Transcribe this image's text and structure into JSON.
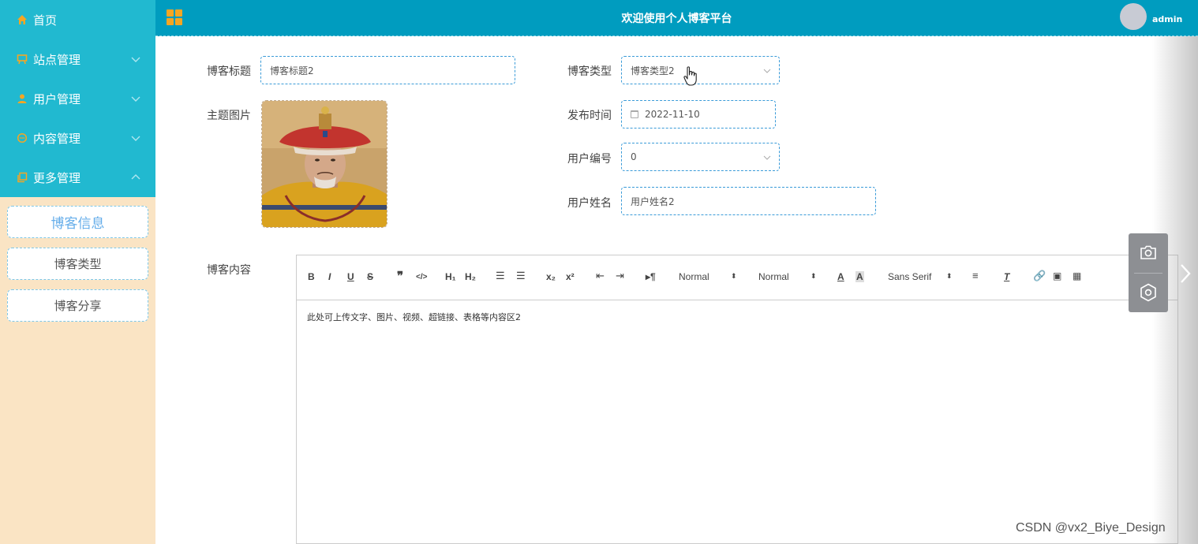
{
  "sidebar": {
    "items": [
      {
        "label": "首页",
        "icon": "home-icon"
      },
      {
        "label": "站点管理",
        "icon": "board-icon"
      },
      {
        "label": "用户管理",
        "icon": "user-icon"
      },
      {
        "label": "内容管理",
        "icon": "chat-icon"
      },
      {
        "label": "更多管理",
        "icon": "copy-icon"
      }
    ],
    "subitems": [
      {
        "label": "博客信息",
        "active": true
      },
      {
        "label": "博客类型"
      },
      {
        "label": "博客分享"
      }
    ]
  },
  "header": {
    "title": "欢迎使用个人博客平台",
    "username": "admin"
  },
  "form": {
    "title_label": "博客标题",
    "title_value": "博客标题2",
    "type_label": "博客类型",
    "type_value": "博客类型2",
    "image_label": "主题图片",
    "time_label": "发布时间",
    "time_value": "2022-11-10",
    "userno_label": "用户编号",
    "userno_value": "0",
    "username_label": "用户姓名",
    "username_value": "用户姓名2",
    "content_label": "博客内容"
  },
  "editor": {
    "header_select": "Normal",
    "size_select": "Normal",
    "font_select": "Sans Serif",
    "content": "此处可上传文字、图片、视频、超链接、表格等内容区2"
  },
  "watermark": "CSDN @vx2_Biye_Design",
  "colors": {
    "sidebar_top": "#21b9d0",
    "sidebar_bg": "#fae4c4",
    "header_bg": "#009cbf",
    "accent": "#3a9bd8"
  }
}
